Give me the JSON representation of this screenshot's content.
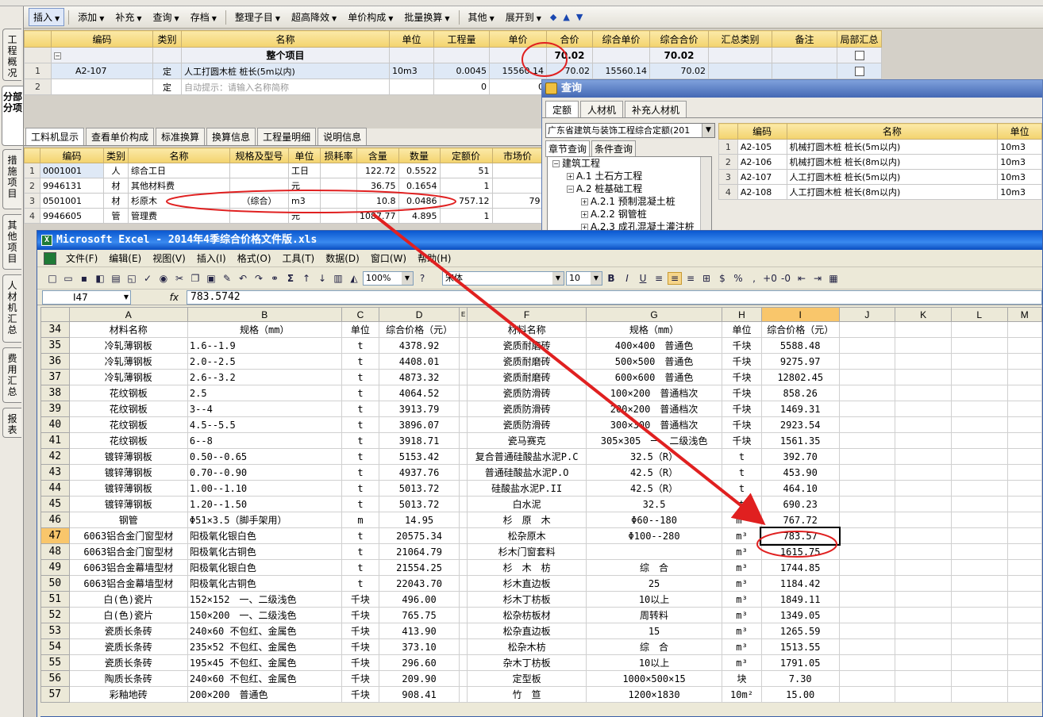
{
  "side_tabs": [
    "工程概况",
    "分部分项",
    "措施项目",
    "其他项目",
    "人材机汇总",
    "费用汇总",
    "报表"
  ],
  "toolbar": {
    "items": [
      "插入",
      "添加",
      "补充",
      "查询",
      "存档",
      "整理子目",
      "超高降效",
      "单价构成",
      "批量换算",
      "其他",
      "展开到"
    ]
  },
  "top_grid": {
    "headers": [
      "",
      "编码",
      "类别",
      "名称",
      "单位",
      "工程量",
      "单价",
      "合价",
      "综合单价",
      "综合合价",
      "汇总类别",
      "备注",
      "局部汇总"
    ],
    "parent_row": {
      "toggle": "−",
      "name": "整个项目",
      "total": "70.02",
      "comp_total": "70.02"
    },
    "rows": [
      {
        "num": "1",
        "code": "A2-107",
        "type": "定",
        "name": "人工打圆木桩 桩长(5m以内)",
        "unit": "10m3",
        "qty": "0.0045",
        "price": "15560.14",
        "total": "70.02",
        "comp_price": "15560.14",
        "comp_total": "70.02"
      },
      {
        "num": "2",
        "code": "",
        "type": "定",
        "name": "自动提示：请输入名称简称",
        "unit": "",
        "qty": "0",
        "price": "0",
        "total": "",
        "comp_price": "",
        "comp_total": ""
      }
    ]
  },
  "sub_tabs": [
    "工料机显示",
    "查看单价构成",
    "标准换算",
    "换算信息",
    "工程量明细",
    "说明信息"
  ],
  "mid_grid": {
    "headers": [
      "",
      "编码",
      "类别",
      "名称",
      "规格及型号",
      "单位",
      "损耗率",
      "含量",
      "数量",
      "定额价",
      "市场价"
    ],
    "rows": [
      {
        "num": "1",
        "code": "0001001",
        "type": "人",
        "name": "综合工日",
        "spec": "",
        "unit": "工日",
        "loss": "",
        "content": "122.72",
        "qty": "0.5522",
        "price": "51",
        "market": ""
      },
      {
        "num": "2",
        "code": "9946131",
        "type": "材",
        "name": "其他材料费",
        "spec": "",
        "unit": "元",
        "loss": "",
        "content": "36.75",
        "qty": "0.1654",
        "price": "1",
        "market": ""
      },
      {
        "num": "3",
        "code": "0501001",
        "type": "材",
        "name": "杉原木",
        "spec": "（综合）",
        "unit": "m3",
        "loss": "",
        "content": "10.8",
        "qty": "0.0486",
        "price": "757.12",
        "market": "79"
      },
      {
        "num": "4",
        "code": "9946605",
        "type": "管",
        "name": "管理费",
        "spec": "",
        "unit": "元",
        "loss": "",
        "content": "1087.77",
        "qty": "4.895",
        "price": "1",
        "market": ""
      }
    ]
  },
  "query": {
    "title": "查询",
    "tabs": [
      "定额",
      "人材机",
      "补充人材机"
    ],
    "book": "广东省建筑与装饰工程综合定额(201",
    "subtabs": [
      "章节查询",
      "条件查询"
    ],
    "tree": [
      {
        "level": 0,
        "box": "−",
        "text": "建筑工程"
      },
      {
        "level": 1,
        "box": "+",
        "text": "A.1 土石方工程"
      },
      {
        "level": 1,
        "box": "−",
        "text": "A.2 桩基础工程"
      },
      {
        "level": 2,
        "box": "+",
        "text": "A.2.1 预制混凝土桩"
      },
      {
        "level": 2,
        "box": "+",
        "text": "A.2.2 钢管桩"
      },
      {
        "level": 2,
        "box": "+",
        "text": "A.2.3 成孔混凝土灌注桩"
      }
    ],
    "headers": [
      "",
      "编码",
      "名称",
      "单位"
    ],
    "rows": [
      {
        "num": "1",
        "code": "A2-105",
        "name": "机械打圆木桩 桩长(5m以内)",
        "unit": "10m3"
      },
      {
        "num": "2",
        "code": "A2-106",
        "name": "机械打圆木桩 桩长(8m以内)",
        "unit": "10m3"
      },
      {
        "num": "3",
        "code": "A2-107",
        "name": "人工打圆木桩 桩长(5m以内)",
        "unit": "10m3"
      },
      {
        "num": "4",
        "code": "A2-108",
        "name": "人工打圆木桩 桩长(8m以内)",
        "unit": "10m3"
      }
    ]
  },
  "excel": {
    "title": "Microsoft Excel - 2014年4季综合价格文件版.xls",
    "menu": [
      "文件(F)",
      "编辑(E)",
      "视图(V)",
      "插入(I)",
      "格式(O)",
      "工具(T)",
      "数据(D)",
      "窗口(W)",
      "帮助(H)"
    ],
    "zoom": "100%",
    "font": "宋体",
    "size": "10",
    "cell_ref": "I47",
    "fx": "fx",
    "formula": "783.5742",
    "columns": [
      "A",
      "B",
      "C",
      "D",
      "E",
      "F",
      "G",
      "H",
      "I",
      "J",
      "K",
      "L",
      "M"
    ],
    "rows": [
      {
        "n": "34",
        "a": "材料名称",
        "b": "规格（mm）",
        "c": "单位",
        "d": "综合价格（元）",
        "f": "材料名称",
        "g": "规格（mm）",
        "h": "单位",
        "i": "综合价格（元）"
      },
      {
        "n": "35",
        "a": "冷轧薄钢板",
        "b": "1.6--1.9",
        "c": "t",
        "d": "4378.92",
        "f": "瓷质耐磨砖",
        "g": "400×400　普通色",
        "h": "千块",
        "i": "5588.48"
      },
      {
        "n": "36",
        "a": "冷轧薄钢板",
        "b": "2.0--2.5",
        "c": "t",
        "d": "4408.01",
        "f": "瓷质耐磨砖",
        "g": "500×500　普通色",
        "h": "千块",
        "i": "9275.97"
      },
      {
        "n": "37",
        "a": "冷轧薄钢板",
        "b": "2.6--3.2",
        "c": "t",
        "d": "4873.32",
        "f": "瓷质耐磨砖",
        "g": "600×600　普通色",
        "h": "千块",
        "i": "12802.45"
      },
      {
        "n": "38",
        "a": "花纹钢板",
        "b": "2.5",
        "c": "t",
        "d": "4064.52",
        "f": "瓷质防滑砖",
        "g": "100×200　普通档次",
        "h": "千块",
        "i": "858.26"
      },
      {
        "n": "39",
        "a": "花纹钢板",
        "b": "3--4",
        "c": "t",
        "d": "3913.79",
        "f": "瓷质防滑砖",
        "g": "200×200　普通档次",
        "h": "千块",
        "i": "1469.31"
      },
      {
        "n": "40",
        "a": "花纹钢板",
        "b": "4.5--5.5",
        "c": "t",
        "d": "3896.07",
        "f": "瓷质防滑砖",
        "g": "300×300　普通档次",
        "h": "千块",
        "i": "2923.54"
      },
      {
        "n": "41",
        "a": "花纹钢板",
        "b": "6--8",
        "c": "t",
        "d": "3918.71",
        "f": "瓷马赛克",
        "g": "305×305　一、二级浅色",
        "h": "千块",
        "i": "1561.35"
      },
      {
        "n": "42",
        "a": "镀锌薄钢板",
        "b": "0.50--0.65",
        "c": "t",
        "d": "5153.42",
        "f": "复合普通硅酸盐水泥P.C",
        "g": "32.5（R）",
        "h": "t",
        "i": "392.70"
      },
      {
        "n": "43",
        "a": "镀锌薄钢板",
        "b": "0.70--0.90",
        "c": "t",
        "d": "4937.76",
        "f": "普通硅酸盐水泥P.O",
        "g": "42.5（R）",
        "h": "t",
        "i": "453.90"
      },
      {
        "n": "44",
        "a": "镀锌薄钢板",
        "b": "1.00--1.10",
        "c": "t",
        "d": "5013.72",
        "f": "硅酸盐水泥P.II",
        "g": "42.5（R）",
        "h": "t",
        "i": "464.10"
      },
      {
        "n": "45",
        "a": "镀锌薄钢板",
        "b": "1.20--1.50",
        "c": "t",
        "d": "5013.72",
        "f": "白水泥",
        "g": "32.5",
        "h": "t",
        "i": "690.23"
      },
      {
        "n": "46",
        "a": "钢管",
        "b": "Φ51×3.5（脚手架用）",
        "c": "m",
        "d": "14.95",
        "f": "杉　原　木",
        "g": "Φ60--180",
        "h": "m³",
        "i": "767.72"
      },
      {
        "n": "47",
        "a": "6063铝合金门窗型材",
        "b": "阳极氧化银白色",
        "c": "t",
        "d": "20575.34",
        "f": "松杂原木",
        "g": "Φ100--280",
        "h": "m³",
        "i": "783.57"
      },
      {
        "n": "48",
        "a": "6063铝合金门窗型材",
        "b": "阳极氧化古铜色",
        "c": "t",
        "d": "21064.79",
        "f": "杉木门窗套料",
        "g": "",
        "h": "m³",
        "i": "1615.75"
      },
      {
        "n": "49",
        "a": "6063铝合金幕墙型材",
        "b": "阳极氧化银白色",
        "c": "t",
        "d": "21554.25",
        "f": "杉　木　枋",
        "g": "综　合",
        "h": "m³",
        "i": "1744.85"
      },
      {
        "n": "50",
        "a": "6063铝合金幕墙型材",
        "b": "阳极氧化古铜色",
        "c": "t",
        "d": "22043.70",
        "f": "杉木直边板",
        "g": "25",
        "h": "m³",
        "i": "1184.42"
      },
      {
        "n": "51",
        "a": "白(色)瓷片",
        "b": "152×152　一、二级浅色",
        "c": "千块",
        "d": "496.00",
        "f": "杉木丁枋板",
        "g": "10以上",
        "h": "m³",
        "i": "1849.11"
      },
      {
        "n": "52",
        "a": "白(色)瓷片",
        "b": "150×200　一、二级浅色",
        "c": "千块",
        "d": "765.75",
        "f": "松杂枋板材",
        "g": "周转料",
        "h": "m³",
        "i": "1349.05"
      },
      {
        "n": "53",
        "a": "瓷质长条砖",
        "b": "240×60 不包红、金属色",
        "c": "千块",
        "d": "413.90",
        "f": "松杂直边板",
        "g": "15",
        "h": "m³",
        "i": "1265.59"
      },
      {
        "n": "54",
        "a": "瓷质长条砖",
        "b": "235×52 不包红、金属色",
        "c": "千块",
        "d": "373.10",
        "f": "松杂木枋",
        "g": "综　合",
        "h": "m³",
        "i": "1513.55"
      },
      {
        "n": "55",
        "a": "瓷质长条砖",
        "b": "195×45 不包红、金属色",
        "c": "千块",
        "d": "296.60",
        "f": "杂木丁枋板",
        "g": "10以上",
        "h": "m³",
        "i": "1791.05"
      },
      {
        "n": "56",
        "a": "陶质长条砖",
        "b": "240×60 不包红、金属色",
        "c": "千块",
        "d": "209.90",
        "f": "定型板",
        "g": "1000×500×15",
        "h": "块",
        "i": "7.30"
      },
      {
        "n": "57",
        "a": "彩釉地砖",
        "b": "200×200　普通色",
        "c": "千块",
        "d": "908.41",
        "f": "竹　笪",
        "g": "1200×1830",
        "h": "10m²",
        "i": "15.00"
      }
    ]
  },
  "annotation_color": "#e02020"
}
